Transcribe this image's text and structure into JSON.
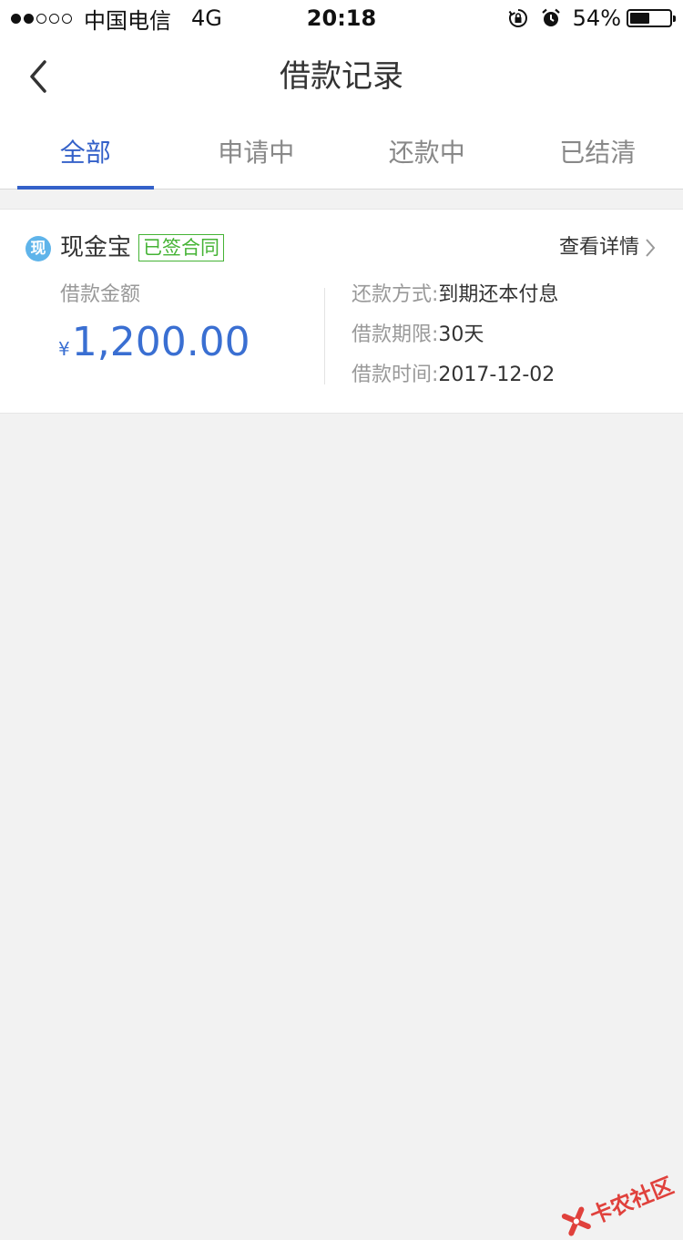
{
  "status_bar": {
    "carrier": "中国电信",
    "network": "4G",
    "time": "20:18",
    "battery": "54%",
    "battery_level": 0.54
  },
  "navbar": {
    "title": "借款记录"
  },
  "tabs": [
    {
      "label": "全部",
      "active": true
    },
    {
      "label": "申请中",
      "active": false
    },
    {
      "label": "还款中",
      "active": false
    },
    {
      "label": "已结清",
      "active": false
    }
  ],
  "loan": {
    "product_icon_char": "现",
    "product_name": "现金宝",
    "status": "已签合同",
    "detail_link": "查看详情",
    "amount_label": "借款金额",
    "currency": "¥",
    "amount": "1,200.00",
    "repay_method_label": "还款方式:",
    "repay_method": "到期还本付息",
    "term_label": "借款期限:",
    "term": "30天",
    "time_label": "借款时间:",
    "time": "2017-12-02"
  },
  "watermark": {
    "text": "卡农社区"
  },
  "colors": {
    "accent": "#3461c9",
    "amount": "#3a6fd2",
    "status_green": "#45b335",
    "icon_blue": "#5fb4ea",
    "watermark_red": "#e0413c"
  }
}
